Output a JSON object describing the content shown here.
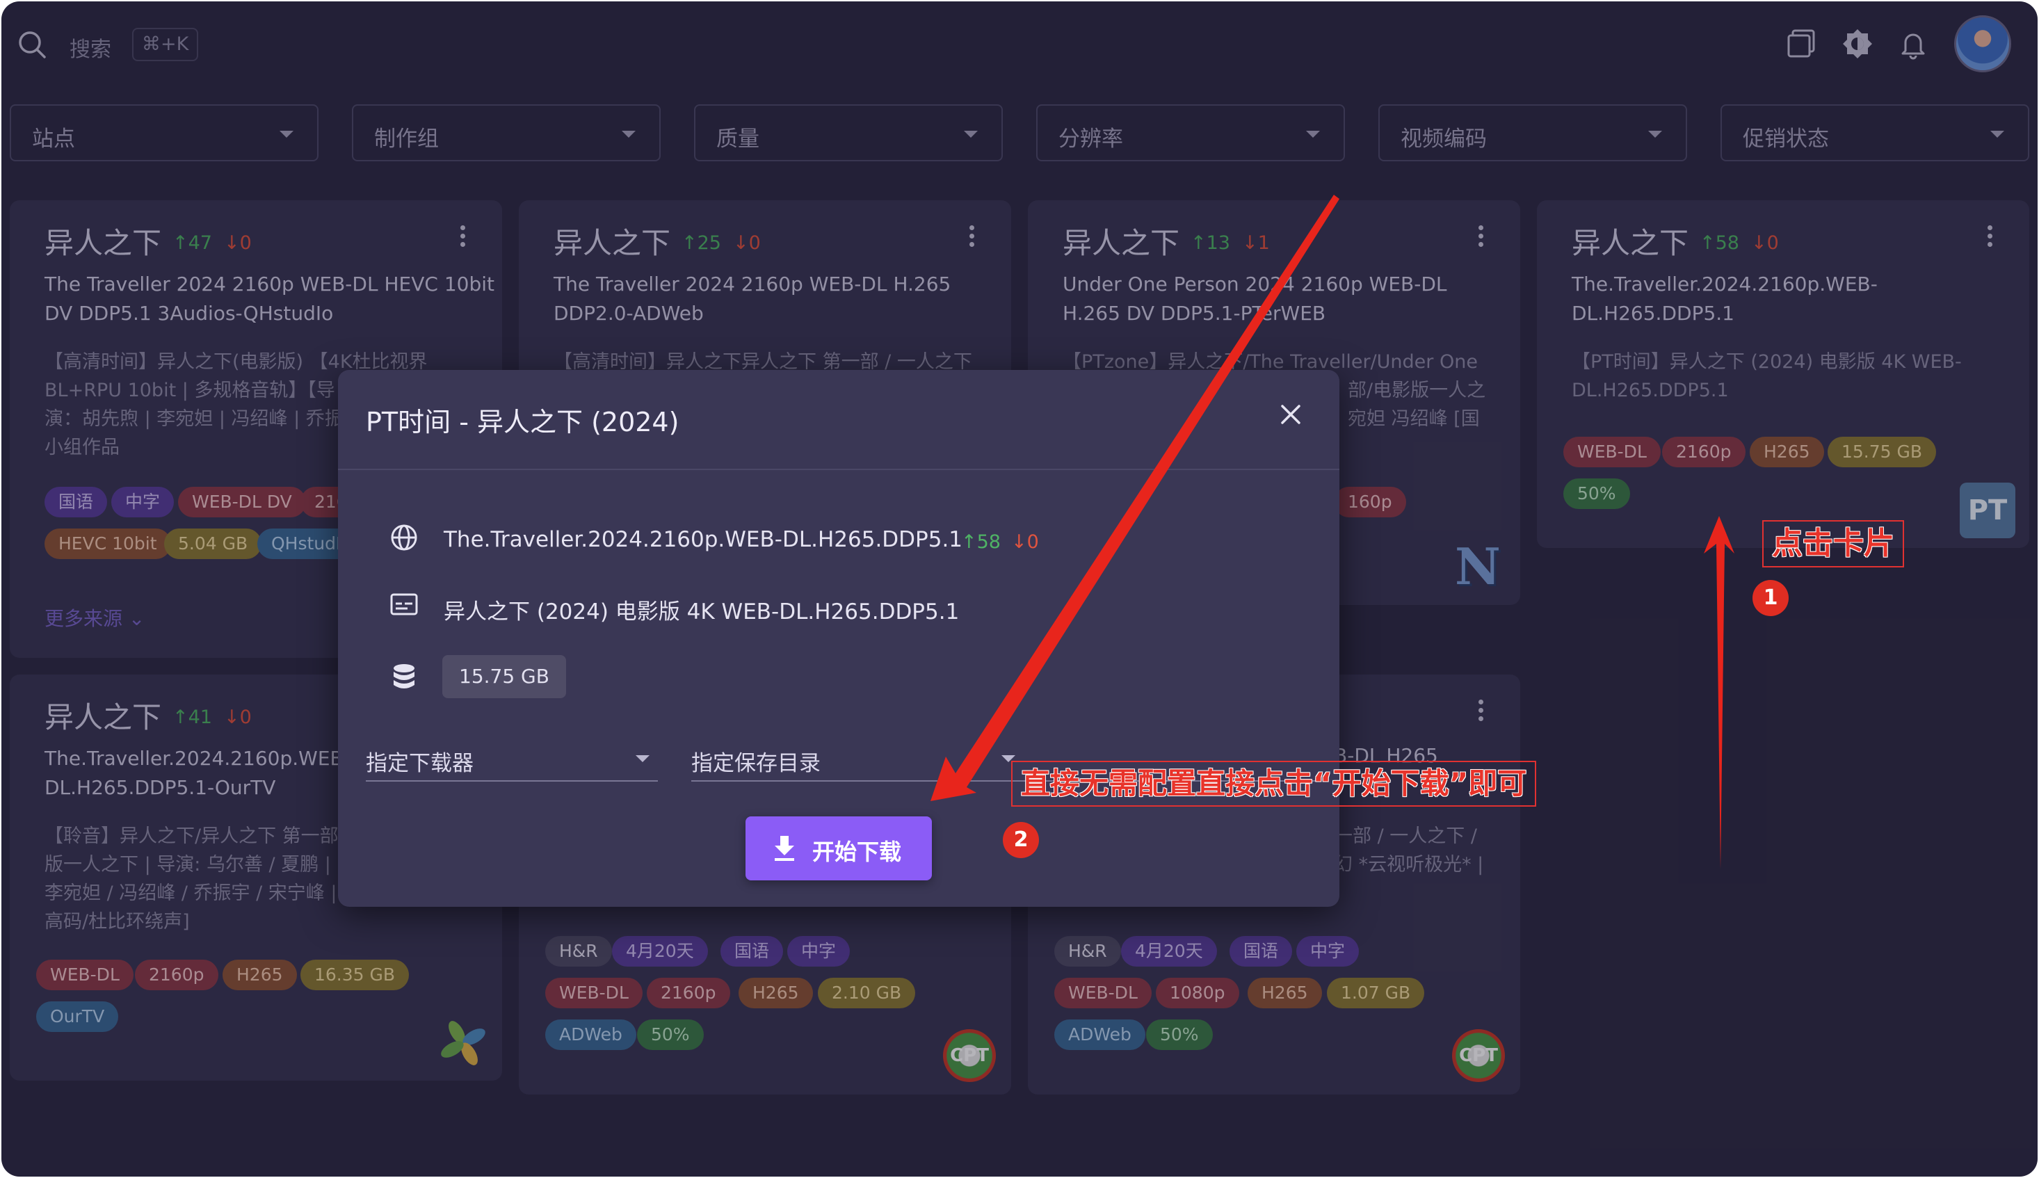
{
  "search": {
    "placeholder": "搜索",
    "shortcut": "⌘+K"
  },
  "topbar_icons": [
    "window-icon",
    "theme-icon",
    "bell-icon",
    "avatar"
  ],
  "filters": [
    {
      "label": "站点"
    },
    {
      "label": "制作组"
    },
    {
      "label": "质量"
    },
    {
      "label": "分辨率"
    },
    {
      "label": "视频编码"
    },
    {
      "label": "促销状态"
    }
  ],
  "cards": [
    {
      "title": "异人之下",
      "seeders": "↑47",
      "leechers": "↓0",
      "name_lines": [
        "The Traveller 2024 2160p WEB-DL HEVC 10bit",
        "DV DDP5.1 3Audios-QHstudIo"
      ],
      "desc_lines": [
        "【高清时间】异人之下(电影版) 【4K杜比视界",
        "BL+RPU 10bit | 多规格音轨】【导",
        "演：胡先煦 | 李宛妲 | 冯绍峰 | 乔振",
        "小组作品"
      ],
      "tags": [
        "国语",
        "中字",
        "WEB-DL DV",
        "216",
        "HEVC 10bit",
        "5.04 GB",
        "QHstudI"
      ],
      "more_sources": "更多来源"
    },
    {
      "title": "异人之下",
      "seeders": "↑25",
      "leechers": "↓0",
      "name_lines": [
        "The Traveller 2024 2160p WEB-DL H.265",
        "DDP2.0-ADWeb"
      ],
      "desc_lines": [
        "【高清时间】异人之下异人之下 第一部 / 一人之下"
      ],
      "tags": [
        "H&R",
        "4月20天",
        "国语",
        "中字",
        "WEB-DL",
        "2160p",
        "H265",
        "2.10 GB",
        "ADWeb",
        "50%"
      ]
    },
    {
      "title": "异人之下",
      "seeders": "↑13",
      "leechers": "↓1",
      "name_lines": [
        "Under One Person 2024 2160p WEB-DL",
        "H.265 DV DDP5.1-PTerWEB"
      ],
      "desc_lines": [
        "【PTzone】异人之下/The Traveller/Under One",
        "部/电影版一人之",
        "宛妲 冯绍峰 [国"
      ],
      "tags": [
        "160p"
      ]
    },
    {
      "title": "异人之下",
      "seeders": "↑58",
      "leechers": "↓0",
      "name_lines": [
        "The.Traveller.2024.2160p.WEB-",
        "DL.H265.DDP5.1"
      ],
      "desc_lines": [
        "【PT时间】异人之下 (2024) 电影版 4K WEB-",
        "DL.H265.DDP5.1"
      ],
      "tags": [
        "WEB-DL",
        "2160p",
        "H265",
        "15.75 GB",
        "50%"
      ],
      "logo": "PT"
    },
    {
      "title": "异人之下",
      "seeders": "↑41",
      "leechers": "↓0",
      "name_lines": [
        "The.Traveller.2024.2160p.WEB-",
        "DL.H265.DDP5.1-OurTV"
      ],
      "desc_lines": [
        "【聆音】异人之下/异人之下 第一部",
        "版一人之下 | 导演: 乌尔善 / 夏鹏 | ",
        "李宛妲 / 冯绍峰 / 乔振宇 / 宋宁峰 |",
        "高码/杜比环绕声]"
      ],
      "tags": [
        "WEB-DL",
        "2160p",
        "H265",
        "16.35 GB",
        "OurTV"
      ]
    },
    {
      "title": "异人之下",
      "seeders": "",
      "leechers": "",
      "name_lines": [
        "B-DL H265"
      ],
      "desc_lines": [
        "一部 / 一人之下 /",
        "幻 *云视听极光* |"
      ],
      "tags": [
        "H&R",
        "4月20天",
        "国语",
        "中字",
        "WEB-DL",
        "1080p",
        "H265",
        "1.07 GB",
        "ADWeb",
        "50%"
      ]
    }
  ],
  "dialog": {
    "title": "PT时间 - 异人之下 (2024)",
    "torrent_name": "The.Traveller.2024.2160p.WEB-DL.H265.DDP5.1",
    "seeders": "↑58",
    "leechers": "↓0",
    "description": "异人之下 (2024) 电影版 4K WEB-DL.H265.DDP5.1",
    "size": "15.75 GB",
    "downloader_label": "指定下载器",
    "save_path_label": "指定保存目录",
    "download_button": "开始下载"
  },
  "annotations": {
    "step1_text": "点击卡片",
    "step1_number": "1",
    "step2_text": "直接无需配置直接点击“开始下载”即可",
    "step2_number": "2",
    "color": "#e8332a"
  },
  "colors": {
    "background": "#2f2c45",
    "card": "#3a3755",
    "accent": "#8b5cf6",
    "seed": "#4fb365",
    "leech": "#e0543f"
  }
}
